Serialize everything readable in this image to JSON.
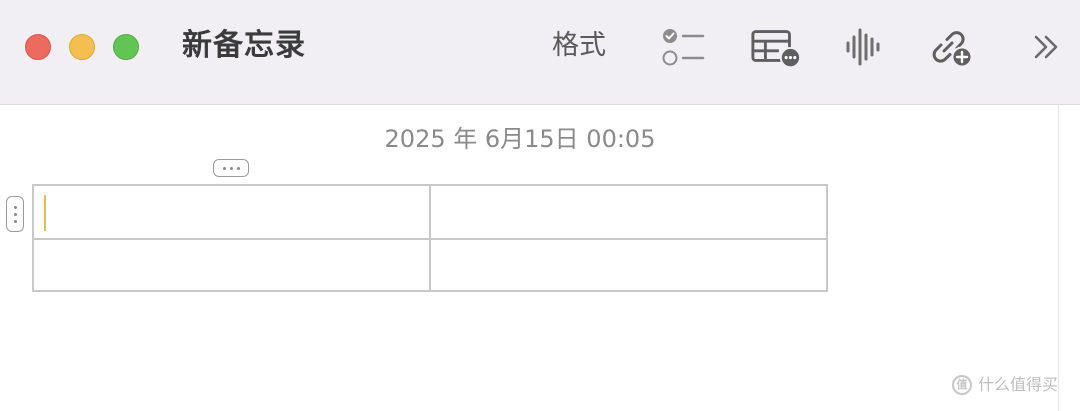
{
  "window": {
    "title": "新备忘录"
  },
  "toolbar": {
    "format_label": "格式",
    "icons": {
      "checklist": "checklist-icon",
      "table": "table-options-icon",
      "audio": "audio-waveform-icon",
      "link": "add-link-icon",
      "more": "chevron-double-right-icon"
    }
  },
  "note": {
    "date": "2025 年 6月15日 00:05",
    "table": {
      "rows": [
        [
          "",
          ""
        ],
        [
          "",
          ""
        ]
      ]
    }
  },
  "watermark": {
    "text": "什么值得买",
    "logo": "值"
  },
  "colors": {
    "toolbar_bg": "#f1eff3",
    "close": "#ec6a5e",
    "minimize": "#f4bf4f",
    "zoom": "#61c554",
    "caret": "#e3c04a"
  }
}
